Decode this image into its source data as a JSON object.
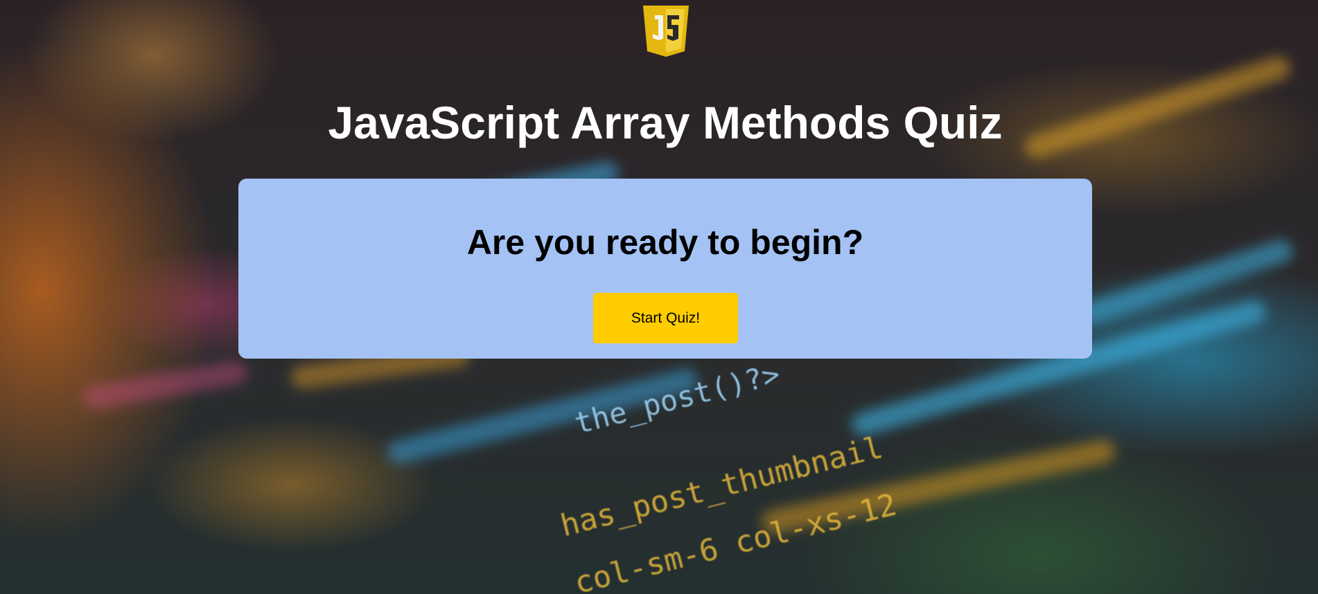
{
  "header": {
    "title": "JavaScript Array Methods Quiz"
  },
  "logo": {
    "icon": "javascript-logo-icon"
  },
  "intro_card": {
    "heading": "Are you ready to begin?",
    "start_button_label": "Start Quiz!"
  },
  "colors": {
    "card_background": "#a4c2f4",
    "button_background": "#ffcc00",
    "title_text": "#ffffff",
    "logo_yellow": "#f0c419"
  },
  "background": {
    "code_line_1": "the_post()?>",
    "code_line_2": "has_post_thumbnail",
    "code_line_3": "col-sm-6 col-xs-12"
  }
}
